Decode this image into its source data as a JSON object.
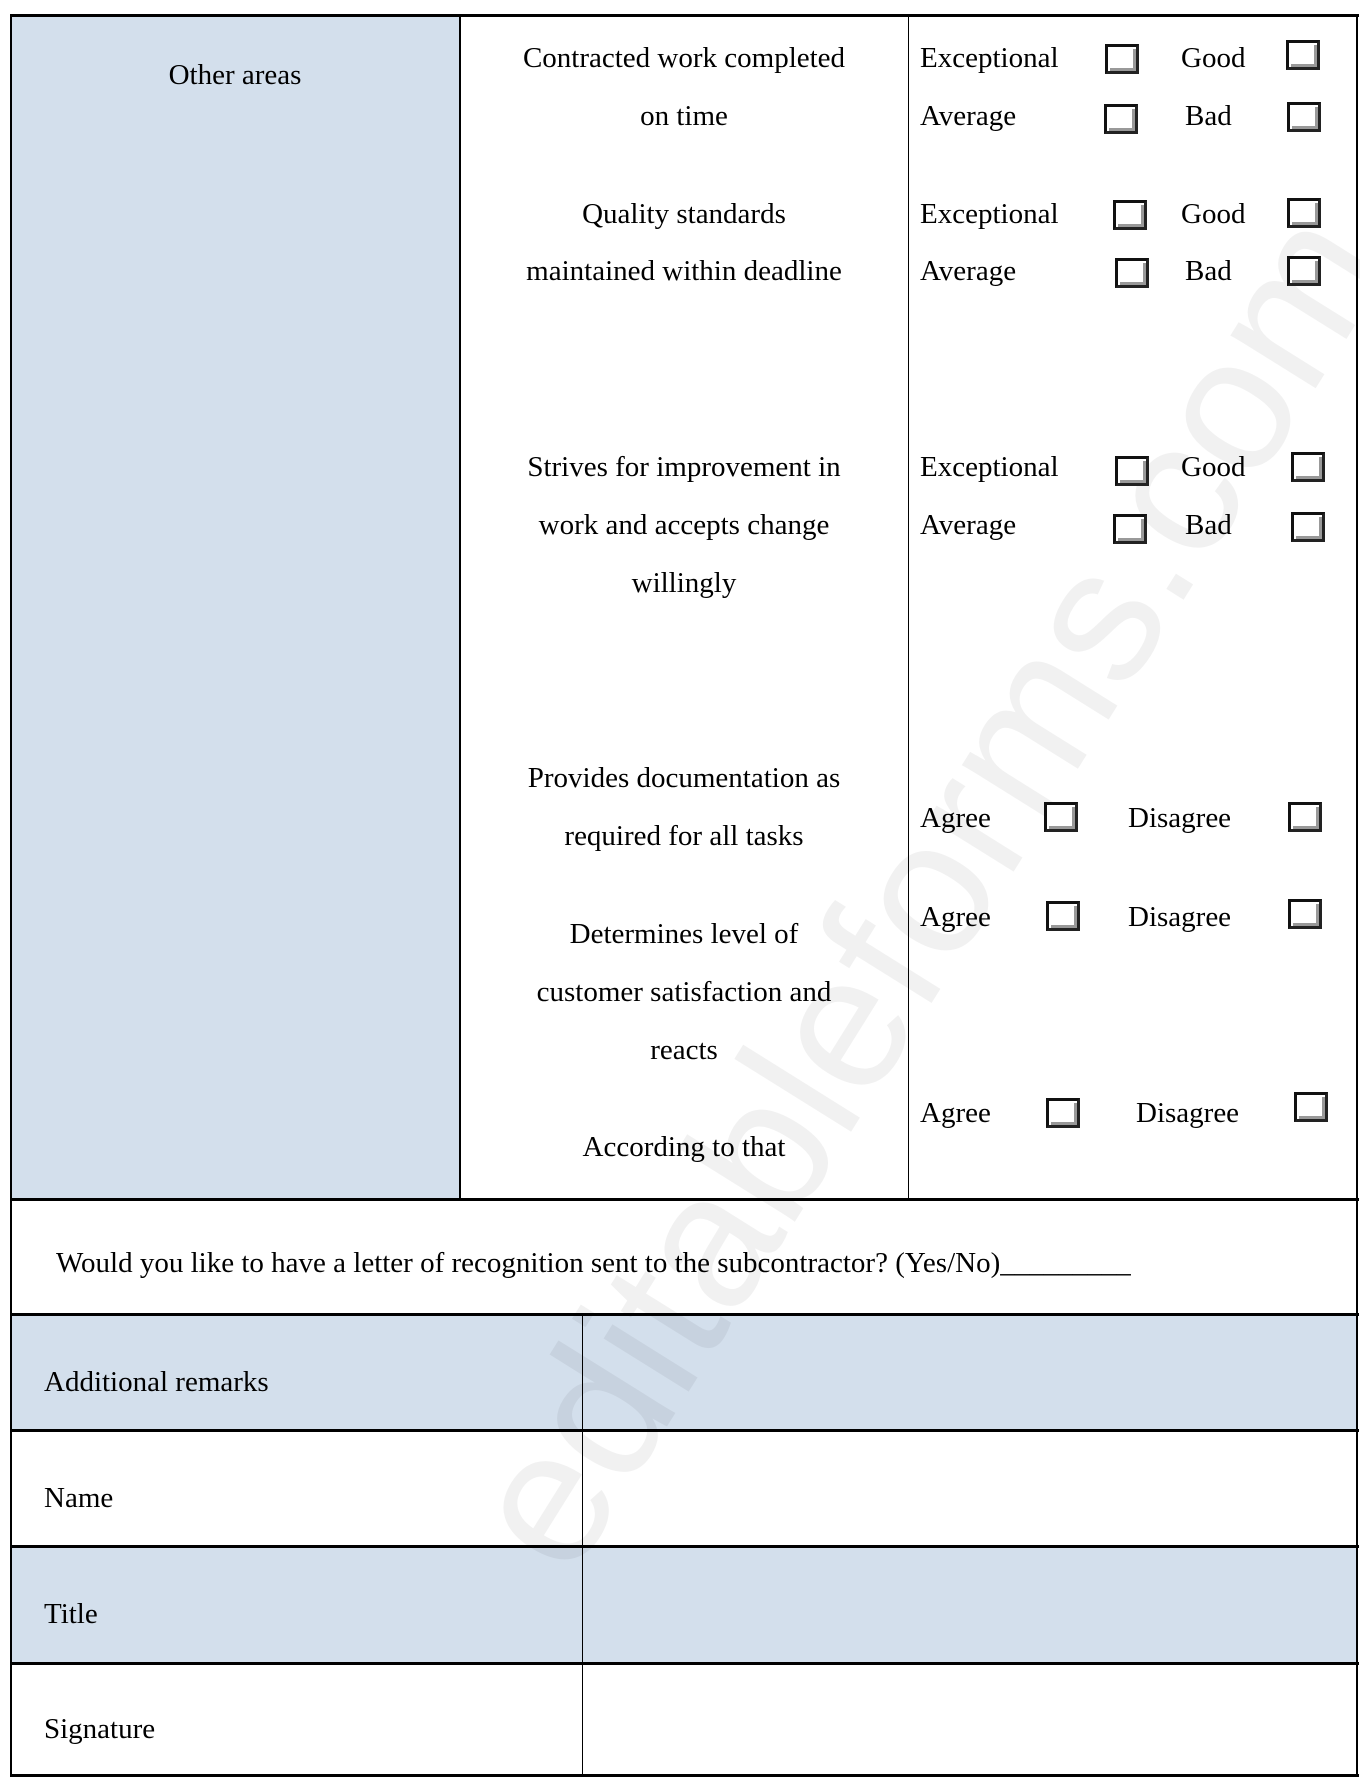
{
  "section_label": "Other areas",
  "criteria": [
    {
      "lines": [
        "Contracted work completed",
        "on time"
      ],
      "options": [
        "Exceptional",
        "Good",
        "Average",
        "Bad"
      ]
    },
    {
      "lines": [
        "Quality standards",
        "maintained within deadline"
      ],
      "options": [
        "Exceptional",
        "Good",
        "Average",
        "Bad"
      ]
    },
    {
      "lines": [
        "Strives for improvement in",
        "work and accepts change",
        "willingly"
      ],
      "options": [
        "Exceptional",
        "Good",
        "Average",
        "Bad"
      ]
    },
    {
      "lines": [
        "Provides documentation as",
        "required for all  tasks"
      ],
      "options": [
        "Agree",
        "Disagree"
      ]
    },
    {
      "lines": [
        "Determines level of",
        "customer satisfaction and",
        "reacts"
      ],
      "options": [
        "Agree",
        "Disagree"
      ]
    },
    {
      "lines": [
        "According to that"
      ],
      "options": [
        "Agree",
        "Disagree"
      ]
    }
  ],
  "question": "Would you like to have a letter of recognition sent to the subcontractor? (Yes/No)_________",
  "fields": [
    {
      "label": "Additional remarks",
      "value": ""
    },
    {
      "label": "Name",
      "value": ""
    },
    {
      "label": "Title",
      "value": ""
    },
    {
      "label": "Signature",
      "value": ""
    }
  ],
  "watermark": "editableforms.com",
  "colors": {
    "shaded_cell": "#d3dfec",
    "border": "#000000"
  }
}
